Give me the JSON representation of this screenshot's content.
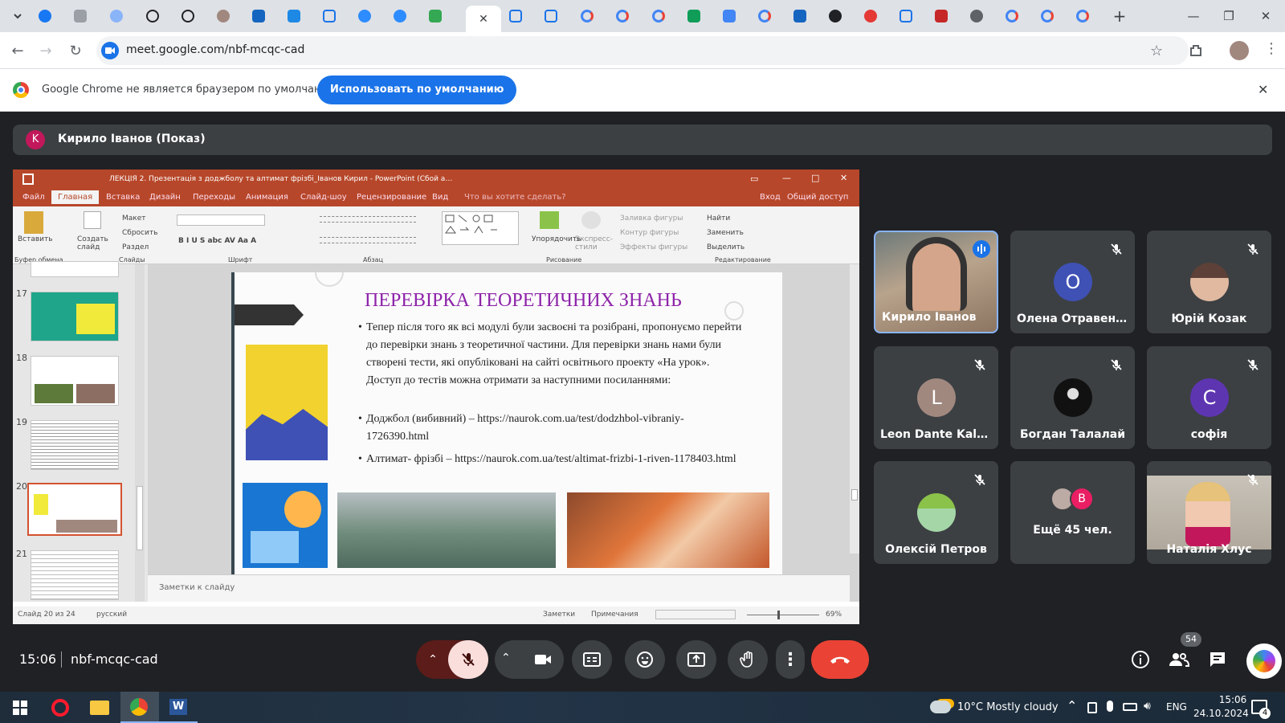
{
  "browser": {
    "url": "meet.google.com/nbf-mcqc-cad",
    "infobar_text": "Google Chrome не является браузером по умолчанию.",
    "infobar_button": "Использовать по умолчанию"
  },
  "presenter_bar": {
    "avatar_letter": "K",
    "title": "Кирило Іванов (Показ)"
  },
  "powerpoint": {
    "window_title": "ЛЕКЦІЯ 2. Презентація з доджболу та алтимат фрізбі_Іванов Кирил - PowerPoint (Сбой активации продукта)",
    "tabs": [
      "Файл",
      "Главная",
      "Вставка",
      "Дизайн",
      "Переходы",
      "Анимация",
      "Слайд-шоу",
      "Рецензирование",
      "Вид",
      "Что вы хотите сделать?"
    ],
    "sign_in": "Вход",
    "share": "Общий доступ",
    "ribbon_groups": [
      "Буфер обмена",
      "Слайды",
      "Шрифт",
      "Абзац",
      "Рисование",
      "Редактирование"
    ],
    "ribbon_items": {
      "paste": "Вставить",
      "new_slide": "Создать слайд",
      "layout": "Макет",
      "reset": "Сбросить",
      "section": "Раздел",
      "arrange": "Упорядочить",
      "quick_styles": "Экспресс-стили",
      "shape_fill": "Заливка фигуры",
      "shape_outline": "Контур фигуры",
      "shape_effects": "Эффекты фигуры",
      "find": "Найти",
      "replace": "Заменить",
      "select": "Выделить"
    },
    "thumb_numbers": [
      "17",
      "18",
      "19",
      "20",
      "21"
    ],
    "slide": {
      "title": "ПЕРЕВІРКА ТЕОРЕТИЧНИХ ЗНАНЬ",
      "paragraph": "Тепер після того як всі модулі були засвоєні та розібрані, пропонуємо перейти до перевірки знань з теоретичної частини. Для перевірки знань нами були створені тести, які опубліковані на сайті освітнього проекту «На урок». Доступ до тестів можна отримати за наступними посиланнями:",
      "bullet1": "Доджбол (вибивний) – https://naurok.com.ua/test/dodzhbol-vibraniy-1726390.html",
      "bullet2": "Алтимат- фрізбі – https://naurok.com.ua/test/altimat-frizbi-1-riven-1178403.html"
    },
    "notes_placeholder": "Заметки к слайду",
    "status": {
      "slide_count": "Слайд 20 из 24",
      "language": "русский",
      "notes": "Заметки",
      "comments": "Примечания",
      "zoom": "69%"
    }
  },
  "participants": [
    {
      "name": "Кирило Іванов",
      "type": "video-speaking"
    },
    {
      "name": "Олена Отравенко",
      "letter": "О",
      "color": "#3f51b5",
      "muted": true
    },
    {
      "name": "Юрій Козак",
      "type": "photo",
      "muted": true
    },
    {
      "name": "Leon Dante Kalaydzhyan",
      "letter": "L",
      "color": "#a1887f",
      "muted": true
    },
    {
      "name": "Богдан Талалай",
      "type": "photo",
      "muted": true
    },
    {
      "name": "софія",
      "letter": "С",
      "color": "#5e35b1",
      "muted": true
    },
    {
      "name": "Олексій Петров",
      "type": "photo",
      "muted": true
    },
    {
      "name": "Ещё 45 чел.",
      "letter": "В",
      "color": "#e91e63"
    },
    {
      "name": "Наталія Хлус",
      "type": "video",
      "muted": true
    }
  ],
  "meet_bar": {
    "time": "15:06",
    "meeting_code": "nbf-mcqc-cad",
    "participants_count": "54"
  },
  "taskbar": {
    "weather": "10°C  Mostly cloudy",
    "language": "ENG",
    "time": "15:06",
    "date": "24.10.2024",
    "notifications": "4"
  }
}
